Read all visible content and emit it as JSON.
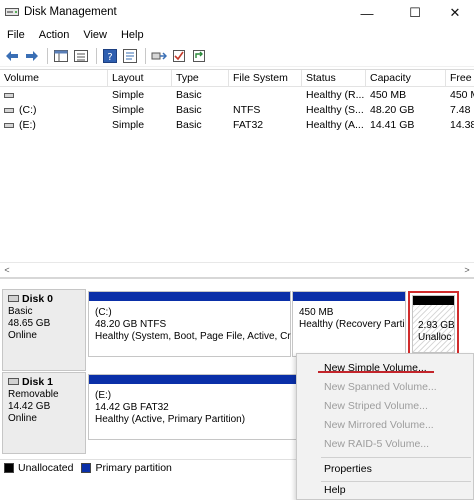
{
  "window": {
    "title": "Disk Management",
    "minimize_glyph": "—",
    "maximize_glyph": "☐",
    "close_glyph": "✕"
  },
  "menu": [
    "File",
    "Action",
    "View",
    "Help"
  ],
  "toolbar": {
    "icons": [
      "back-arrow-icon",
      "forward-arrow-icon",
      "console-tree-icon",
      "help-icon",
      "properties-icon",
      "connect-icon",
      "checklist-icon",
      "refresh-icon"
    ]
  },
  "volume_list": {
    "columns": [
      "Volume",
      "Layout",
      "Type",
      "File System",
      "Status",
      "Capacity",
      "Free"
    ],
    "rows": [
      [
        "",
        "Simple",
        "Basic",
        "",
        "Healthy (R...",
        "450 MB",
        "450 M"
      ],
      [
        "(C:)",
        "Simple",
        "Basic",
        "NTFS",
        "Healthy (S...",
        "48.20 GB",
        "7.48"
      ],
      [
        "(E:)",
        "Simple",
        "Basic",
        "FAT32",
        "Healthy (A...",
        "14.41 GB",
        "14.38"
      ]
    ]
  },
  "scrollbar": {
    "left": "<",
    "right": ">"
  },
  "disks": [
    {
      "name": "Disk 0",
      "type": "Basic",
      "size": "48.65 GB",
      "status": "Online",
      "partitions": [
        {
          "line1": "(C:)",
          "line2": "48.20 GB NTFS",
          "line3": "Healthy (System, Boot, Page File, Active, Cr"
        },
        {
          "line1": "",
          "line2": "450 MB",
          "line3": "Healthy (Recovery Parti"
        }
      ],
      "unallocated": {
        "line1": "2.93 GB",
        "line2": "Unalloc"
      }
    },
    {
      "name": "Disk 1",
      "type": "Removable",
      "size": "14.42 GB",
      "status": "Online",
      "partitions": [
        {
          "line1": "(E:)",
          "line2": "14.42 GB FAT32",
          "line3": "Healthy (Active, Primary Partition)"
        }
      ]
    }
  ],
  "legend": [
    {
      "label": "Unallocated",
      "color": "#000000"
    },
    {
      "label": "Primary partition",
      "color": "#0a2fa8"
    }
  ],
  "context_menu": {
    "items": [
      {
        "label": "New Simple Volume...",
        "enabled": true
      },
      {
        "label": "New Spanned Volume...",
        "enabled": false
      },
      {
        "label": "New Striped Volume...",
        "enabled": false
      },
      {
        "label": "New Mirrored Volume...",
        "enabled": false
      },
      {
        "label": "New RAID-5 Volume...",
        "enabled": false
      },
      {
        "label": "Properties",
        "enabled": true
      },
      {
        "label": "Help",
        "enabled": true
      }
    ]
  },
  "colors": {
    "primary_partition": "#0a2fa8",
    "unallocated": "#000000",
    "highlight": "#d12c2c"
  }
}
